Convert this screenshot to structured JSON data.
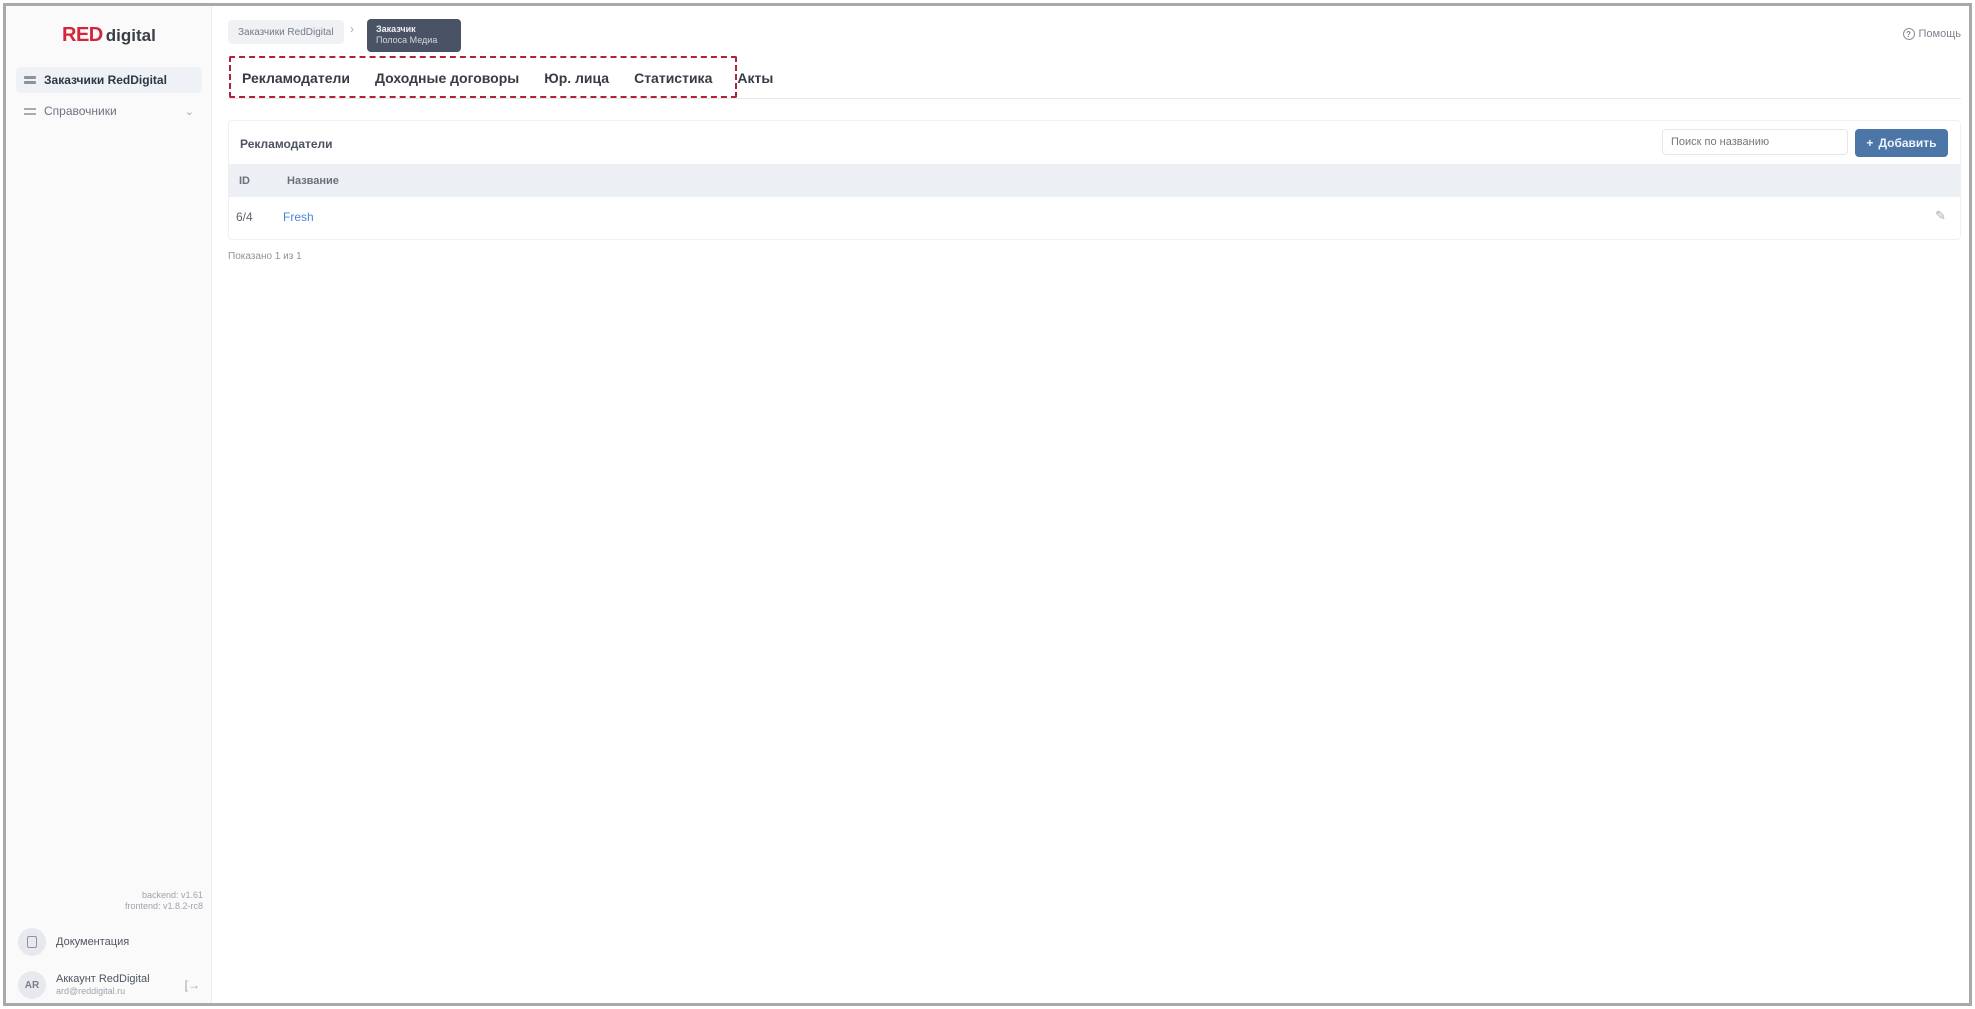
{
  "brand": {
    "red": "RED",
    "digital": "digital",
    "accent": "#d4263a"
  },
  "sidebar": {
    "items": [
      {
        "label": "Заказчики RedDigital",
        "icon": "grid-icon",
        "active": true
      },
      {
        "label": "Справочники",
        "icon": "list-icon",
        "active": false
      }
    ],
    "versions": {
      "backend": "backend: v1.61",
      "frontend": "frontend: v1.8.2-rc8"
    },
    "docs_label": "Документация",
    "account": {
      "initials": "AR",
      "name": "Аккаунт RedDigital",
      "email": "ard@reddigital.ru"
    }
  },
  "breadcrumb": {
    "root": "Заказчики RedDigital",
    "separator": "›",
    "current_title": "Заказчик",
    "current_sub": "Полоса Медиа"
  },
  "help_label": "Помощь",
  "tabs": [
    {
      "label": "Рекламодатели"
    },
    {
      "label": "Доходные договоры"
    },
    {
      "label": "Юр. лица"
    },
    {
      "label": "Статистика"
    },
    {
      "label": "Акты"
    }
  ],
  "card": {
    "title": "Рекламодатели",
    "search_placeholder": "Поиск по названию",
    "add_label": "Добавить",
    "columns": {
      "id": "ID",
      "name": "Название"
    },
    "rows": [
      {
        "id": "6/4",
        "name": "Fresh"
      }
    ]
  },
  "shown_text": "Показано 1 из 1",
  "colors": {
    "primary": "#4d76a8",
    "link": "#4d86d8",
    "highlight": "#b0233a"
  }
}
